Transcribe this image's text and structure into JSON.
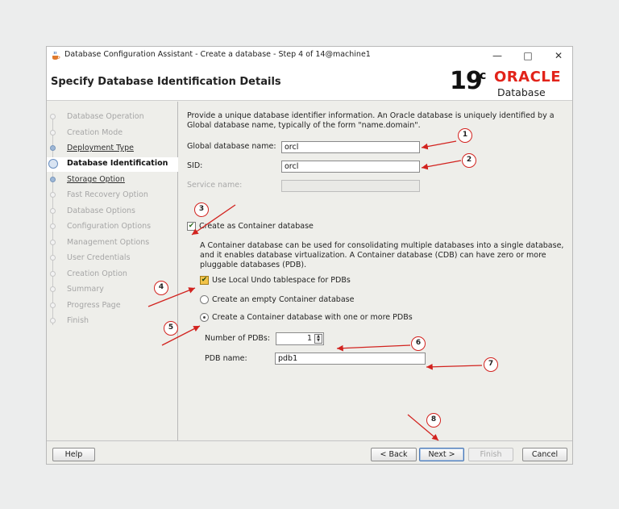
{
  "window": {
    "title": "Database Configuration Assistant - Create a database - Step 4 of 14@machine1",
    "controls": {
      "minimize": "—",
      "maximize": "□",
      "close": "✕"
    }
  },
  "header": {
    "page_title": "Specify Database Identification Details",
    "logo": {
      "version": "19",
      "version_sup": "c",
      "brand": "ORACLE",
      "product": "Database"
    }
  },
  "sidebar": {
    "steps": [
      {
        "label": "Database Operation",
        "state": "disabled"
      },
      {
        "label": "Creation Mode",
        "state": "disabled"
      },
      {
        "label": "Deployment Type",
        "state": "link"
      },
      {
        "label": "Database Identification",
        "state": "current"
      },
      {
        "label": "Storage Option",
        "state": "link"
      },
      {
        "label": "Fast Recovery Option",
        "state": "disabled"
      },
      {
        "label": "Database Options",
        "state": "disabled"
      },
      {
        "label": "Configuration Options",
        "state": "disabled"
      },
      {
        "label": "Management Options",
        "state": "disabled"
      },
      {
        "label": "User Credentials",
        "state": "disabled"
      },
      {
        "label": "Creation Option",
        "state": "disabled"
      },
      {
        "label": "Summary",
        "state": "disabled"
      },
      {
        "label": "Progress Page",
        "state": "disabled"
      },
      {
        "label": "Finish",
        "state": "disabled"
      }
    ]
  },
  "form": {
    "intro_line1": "Provide a unique database identifier information. An Oracle database is uniquely identified by a",
    "intro_line2": "Global database name, typically of the form \"name.domain\".",
    "global_db_name": {
      "label": "Global database name:",
      "value": "orcl"
    },
    "sid": {
      "label": "SID:",
      "value": "orcl"
    },
    "service_name": {
      "label": "Service name:",
      "value": ""
    },
    "container_db": {
      "label": "Create as Container database",
      "checked": true
    },
    "container_desc_line1": "A Container database can be used for consolidating multiple databases into a single database,",
    "container_desc_line2": "and it enables database virtualization. A Container database (CDB) can have zero or more",
    "container_desc_line3": "pluggable databases (PDB).",
    "local_undo": {
      "label": "Use Local Undo tablespace for PDBs",
      "checked": true
    },
    "empty_cdb": {
      "label": "Create an empty Container database",
      "selected": false
    },
    "cdb_with_pdbs": {
      "label": "Create a Container database with one or more PDBs",
      "selected": true
    },
    "num_pdbs": {
      "label": "Number of PDBs:",
      "value": "1"
    },
    "pdb_name": {
      "label": "PDB name:",
      "value": "pdb1"
    }
  },
  "buttons": {
    "help": "Help",
    "back": "< Back",
    "next": "Next >",
    "finish": "Finish",
    "cancel": "Cancel"
  },
  "annotations": {
    "numbers": [
      "1",
      "2",
      "3",
      "4",
      "5",
      "6",
      "7",
      "8"
    ],
    "color": "#d2231f"
  },
  "colors": {
    "oracle_red": "#e2231a",
    "accent_blue": "#4c78b4",
    "checkbox_amber": "#f2c34a"
  }
}
